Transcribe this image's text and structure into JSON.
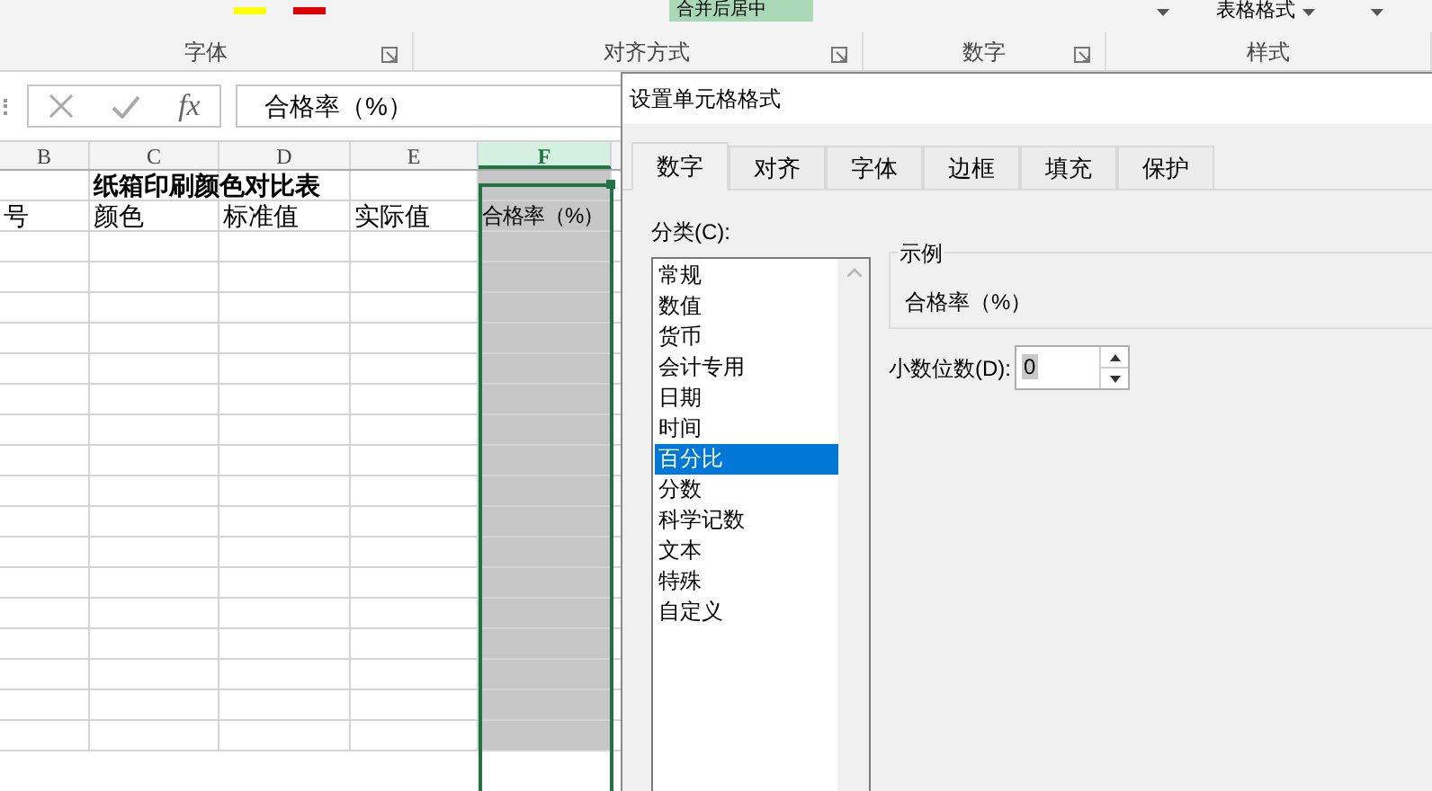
{
  "ribbon": {
    "merge_button": {
      "label": "合并后居中"
    },
    "table_format": {
      "label": "表格格式"
    },
    "groups": [
      {
        "label": "字体"
      },
      {
        "label": "对齐方式"
      },
      {
        "label": "数字"
      },
      {
        "label": "样式"
      }
    ]
  },
  "formula_bar": {
    "function_label": "fx",
    "content": "合格率（%）"
  },
  "sheet": {
    "columns": [
      {
        "label": "B",
        "selected": false
      },
      {
        "label": "C",
        "selected": false
      },
      {
        "label": "D",
        "selected": false
      },
      {
        "label": "E",
        "selected": false
      },
      {
        "label": "F",
        "selected": true
      }
    ],
    "rows": [
      {
        "kind": "title",
        "text": "纸箱印刷颜色对比表"
      },
      {
        "kind": "cells",
        "cells": [
          "号",
          "颜色",
          "标准值",
          "实际值",
          "合格率（%）"
        ]
      }
    ]
  },
  "dialog": {
    "title": "设置单元格格式",
    "tabs": [
      {
        "label": "数字",
        "selected": true
      },
      {
        "label": "对齐",
        "selected": false
      },
      {
        "label": "字体",
        "selected": false
      },
      {
        "label": "边框",
        "selected": false
      },
      {
        "label": "填充",
        "selected": false
      },
      {
        "label": "保护",
        "selected": false
      }
    ],
    "category_label": "分类(C):",
    "categories": [
      {
        "label": "常规",
        "selected": false
      },
      {
        "label": "数值",
        "selected": false
      },
      {
        "label": "货币",
        "selected": false
      },
      {
        "label": "会计专用",
        "selected": false
      },
      {
        "label": "日期",
        "selected": false
      },
      {
        "label": "时间",
        "selected": false
      },
      {
        "label": "百分比",
        "selected": true
      },
      {
        "label": "分数",
        "selected": false
      },
      {
        "label": "科学记数",
        "selected": false
      },
      {
        "label": "文本",
        "selected": false
      },
      {
        "label": "特殊",
        "selected": false
      },
      {
        "label": "自定义",
        "selected": false
      }
    ],
    "sample": {
      "legend": "示例",
      "value": "合格率（%）"
    },
    "decimal": {
      "label": "小数位数(D):",
      "value": "0"
    }
  }
}
